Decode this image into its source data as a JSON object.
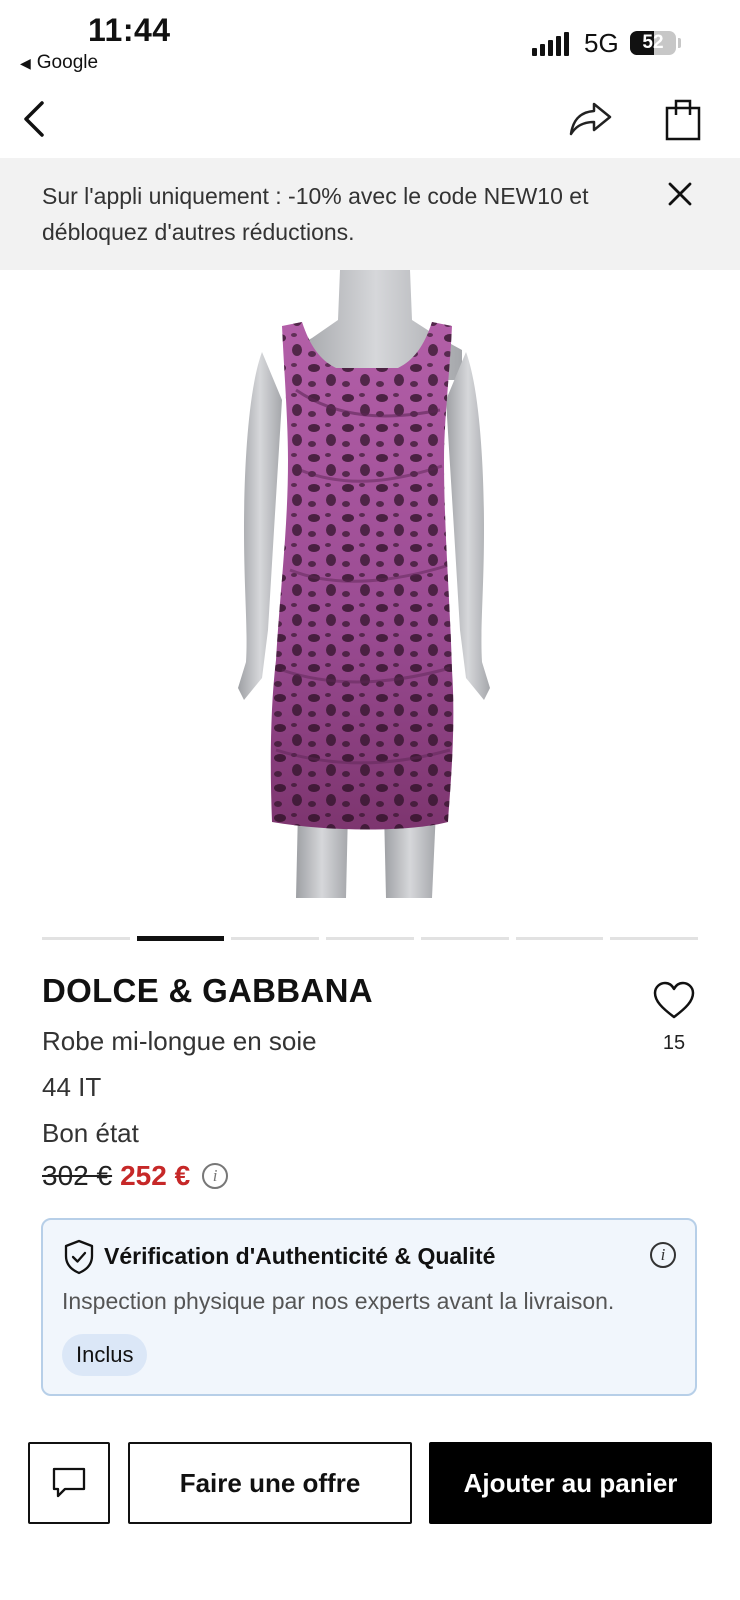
{
  "status_bar": {
    "time": "11:44",
    "back_app": "Google",
    "network": "5G",
    "battery": "52",
    "battery_level": 0.52
  },
  "nav": {
    "icons": [
      "back-chevron-icon",
      "share-icon",
      "shopping-bag-icon"
    ]
  },
  "promo_banner": {
    "text": "Sur l'appli uniquement : -10% avec le code NEW10 et débloquez d'autres réductions.",
    "close_icon": "close-icon"
  },
  "gallery": {
    "image": "Pink and black leopard print silk dress on a grey mannequin",
    "total_images": 7,
    "active_index": 1
  },
  "product": {
    "brand": "DOLCE & GABBANA",
    "description": "Robe mi-longue en soie",
    "size": "44 IT",
    "condition": "Bon état",
    "old_price": "302 €",
    "price": "252 €",
    "likes": "15"
  },
  "authenticity": {
    "title": "Vérification d'Authenticité & Qualité",
    "subtitle": "Inspection physique par nos experts avant la livraison.",
    "badge": "Inclus"
  },
  "actions": {
    "offer_label": "Faire une offre",
    "cart_label": "Ajouter au panier"
  },
  "colors": {
    "price_red": "#c62828",
    "card_border": "#b7cfe8",
    "card_bg": "#f1f6fc",
    "badge_bg": "#dbe7f7",
    "banner_bg": "#f2f2f2"
  }
}
